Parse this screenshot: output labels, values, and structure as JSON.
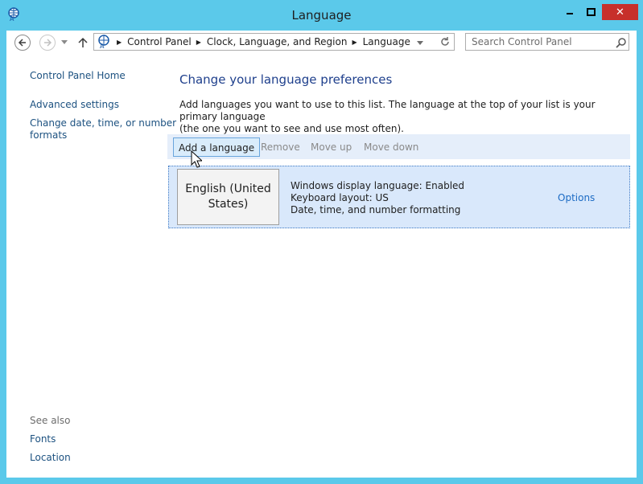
{
  "window": {
    "title": "Language",
    "close_glyph": "✕"
  },
  "icons": {
    "app": "language-control-panel-icon",
    "minimize": "minimize-icon",
    "maximize": "maximize-icon",
    "close": "close-icon",
    "back": "back-arrow-icon",
    "forward": "forward-arrow-icon",
    "history": "chevron-down-icon",
    "up": "up-arrow-icon",
    "refresh": "refresh-icon",
    "search": "search-icon",
    "cursor": "mouse-pointer-icon"
  },
  "address": {
    "crumbs": [
      "Control Panel",
      "Clock, Language, and Region",
      "Language"
    ],
    "separator": "▶"
  },
  "search": {
    "placeholder": "Search Control Panel"
  },
  "sidebar": {
    "home": "Control Panel Home",
    "links": [
      "Advanced settings",
      "Change date, time, or number",
      "formats"
    ],
    "see_also_label": "See also",
    "see_also": [
      "Fonts",
      "Location"
    ]
  },
  "main": {
    "heading": "Change your language preferences",
    "description_line1": "Add languages you want to use to this list. The language at the top of your list is your primary language",
    "description_line2": "(the one you want to see and use most often)."
  },
  "toolbar": {
    "add": "Add a language",
    "remove": "Remove",
    "move_up": "Move up",
    "move_down": "Move down"
  },
  "languages": [
    {
      "name_line1": "English (United",
      "name_line2": "States)",
      "details": [
        "Windows display language: Enabled",
        "Keyboard layout: US",
        "Date, time, and number formatting"
      ],
      "options": "Options"
    }
  ],
  "colors": {
    "frame": "#5bc9ea",
    "close_button": "#c7302b",
    "heading": "#1e3f8c",
    "link": "#1c5180",
    "selection": "#d9e8fb"
  }
}
